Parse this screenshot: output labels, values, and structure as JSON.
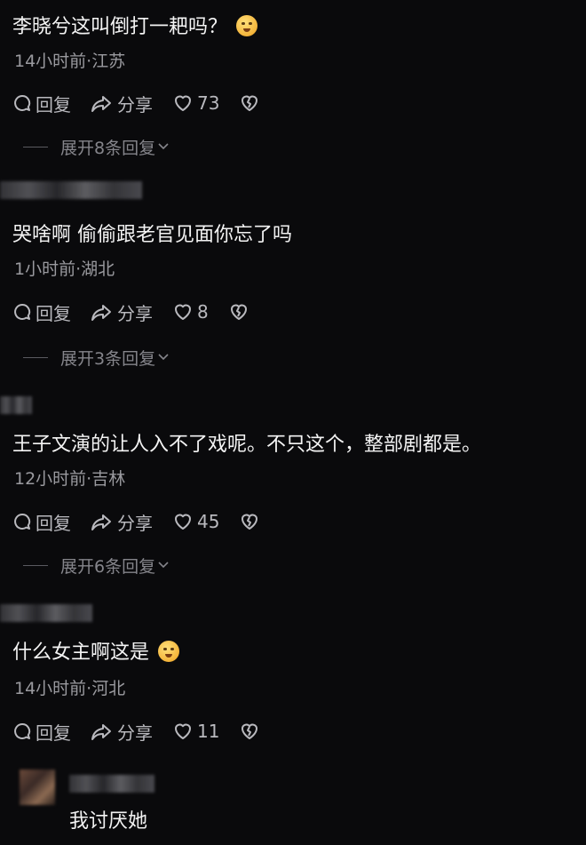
{
  "comments": [
    {
      "text": "李晓兮这叫倒打一耙吗？",
      "meta": "14小时前·江苏",
      "reply_label": "回复",
      "share_label": "分享",
      "likes": "73",
      "expand": "展开8条回复",
      "emoji": "smirk-emoji"
    },
    {
      "text": "哭啥啊 偷偷跟老官见面你忘了吗",
      "meta": "1小时前·湖北",
      "reply_label": "回复",
      "share_label": "分享",
      "likes": "8",
      "expand": "展开3条回复"
    },
    {
      "text": "王子文演的让人入不了戏呢。不只这个，整部剧都是。",
      "meta": "12小时前·吉林",
      "reply_label": "回复",
      "share_label": "分享",
      "likes": "45",
      "expand": "展开6条回复"
    },
    {
      "text": "什么女主啊这是",
      "meta": "14小时前·河北",
      "reply_label": "回复",
      "share_label": "分享",
      "likes": "11",
      "emoji": "rolling-eyes-emoji"
    }
  ],
  "last_reply": {
    "text": "我讨厌她"
  },
  "icons": {
    "reply": "comment-bubble-icon",
    "share": "share-arrow-icon",
    "like": "heart-icon",
    "dislike": "broken-heart-icon",
    "expand": "chevron-down-icon"
  },
  "colors": {
    "background": "#0a0a0c",
    "text": "#f4f4f4",
    "meta": "#9a9a9f",
    "action": "#b9b9be"
  }
}
